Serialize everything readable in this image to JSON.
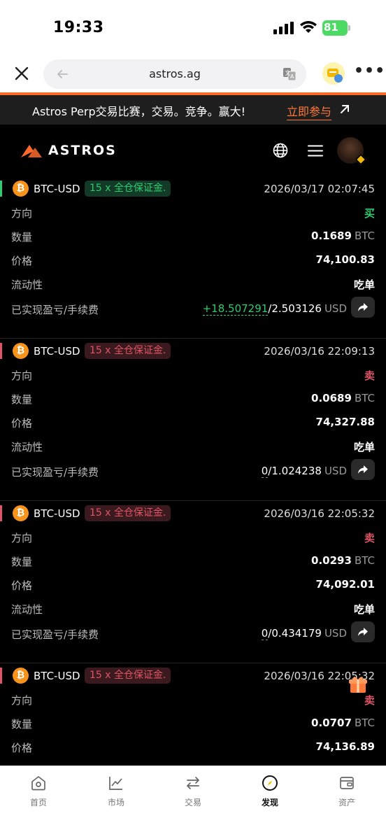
{
  "status_bar": {
    "time": "19:33",
    "battery": "81"
  },
  "browser": {
    "url": "astros.ag"
  },
  "banner": {
    "text": "Astros Perp交易比赛，交易。竞争。赢大!",
    "cta": "立即参与"
  },
  "app": {
    "brand": "ASTROS"
  },
  "labels": {
    "direction": "方向",
    "quantity": "数量",
    "price": "价格",
    "liquidity": "流动性",
    "pnl_fee": "已实现盈亏/手续费"
  },
  "trades": [
    {
      "coin_symbol": "₿",
      "pair": "BTC-USD",
      "tag": "15 x 全仓保证金.",
      "datetime": "2026/03/17 02:07:45",
      "direction": "买",
      "quantity": "0.1689",
      "quantity_unit": "BTC",
      "price": "74,100.83",
      "liquidity": "吃单",
      "pnl": "+18.507291",
      "fee": "/2.503126",
      "fee_unit": "USD",
      "side": "buy"
    },
    {
      "coin_symbol": "₿",
      "pair": "BTC-USD",
      "tag": "15 x 全仓保证金.",
      "datetime": "2026/03/16 22:09:13",
      "direction": "卖",
      "quantity": "0.0689",
      "quantity_unit": "BTC",
      "price": "74,327.88",
      "liquidity": "吃单",
      "pnl": "0",
      "fee": "/1.024238",
      "fee_unit": "USD",
      "side": "sell"
    },
    {
      "coin_symbol": "₿",
      "pair": "BTC-USD",
      "tag": "15 x 全仓保证金.",
      "datetime": "2026/03/16 22:05:32",
      "direction": "卖",
      "quantity": "0.0293",
      "quantity_unit": "BTC",
      "price": "74,092.01",
      "liquidity": "吃单",
      "pnl": "0",
      "fee": "/0.434179",
      "fee_unit": "USD",
      "side": "sell"
    },
    {
      "coin_symbol": "₿",
      "pair": "BTC-USD",
      "tag": "15 x 全仓保证金.",
      "datetime": "2026/03/16 22:05:32",
      "direction": "卖",
      "quantity": "0.0707",
      "quantity_unit": "BTC",
      "price": "74,136.89",
      "side": "sell"
    }
  ],
  "nav": [
    {
      "label": "首页",
      "icon": "home-icon"
    },
    {
      "label": "市场",
      "icon": "market-chart-icon"
    },
    {
      "label": "交易",
      "icon": "trade-swap-icon"
    },
    {
      "label": "发现",
      "icon": "discover-compass-icon",
      "active": true
    },
    {
      "label": "资产",
      "icon": "wallet-icon"
    }
  ],
  "colors": {
    "buy": "#2ecc71",
    "sell": "#e05565",
    "accent": "#ff6a2a",
    "bitcoin": "#f7931a"
  }
}
